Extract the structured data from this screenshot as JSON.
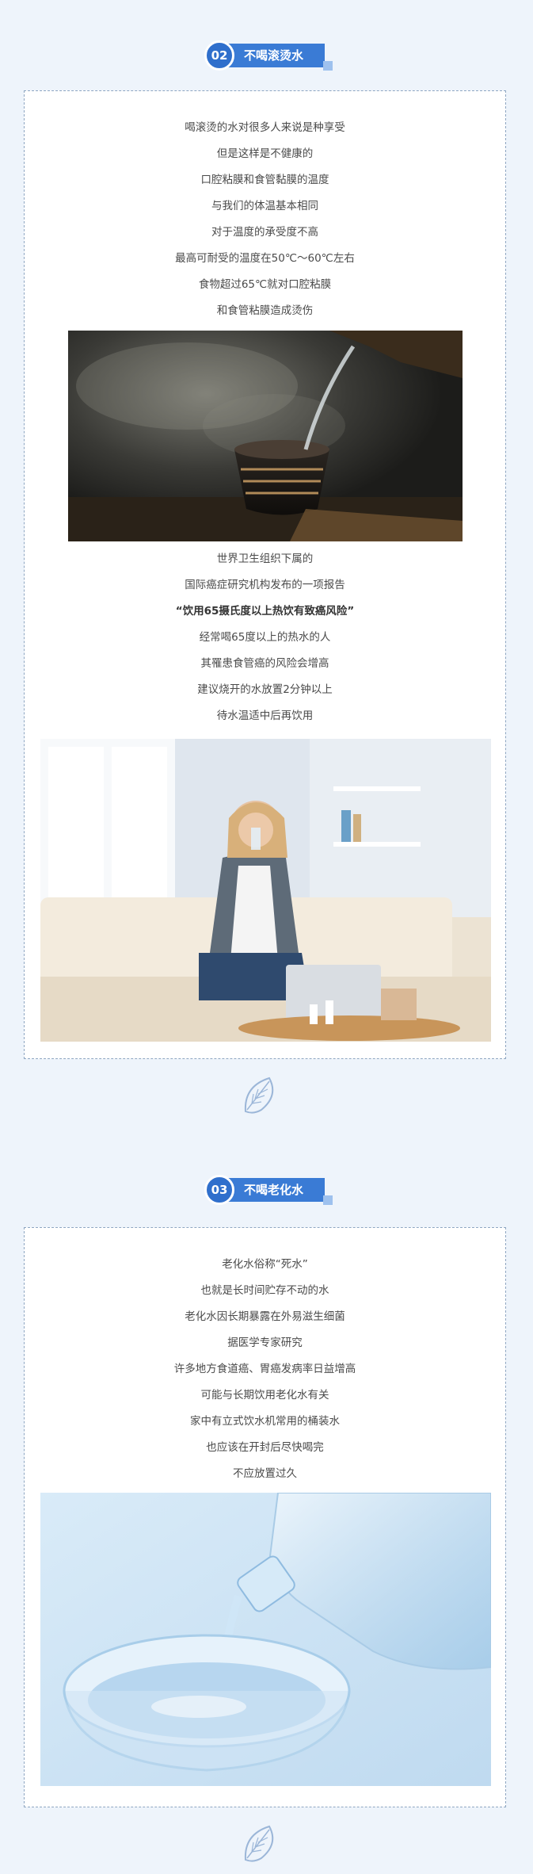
{
  "section2": {
    "number": "02",
    "title": "不喝滚烫水",
    "paragraph1": [
      "喝滚烫的水对很多人来说是种享受",
      "但是这样是不健康的",
      "口腔粘膜和食管黏膜的温度",
      "与我们的体温基本相同",
      "对于温度的承受度不高",
      "最高可耐受的温度在50℃～60℃左右",
      "食物超过65℃就对口腔粘膜",
      "和食管粘膜造成烫伤"
    ],
    "paragraph2": [
      "世界卫生组织下属的",
      "国际癌症研究机构发布的一项报告",
      "“饮用65摄氏度以上热饮有致癌风险”",
      "经常喝65度以上的热水的人",
      "其罹患食管癌的风险会增高",
      "建议烧开的水放置2分钟以上",
      "待水温适中后再饮用"
    ]
  },
  "section3": {
    "number": "03",
    "title": "不喝老化水",
    "paragraph1": [
      "老化水俗称“死水”",
      "也就是长时间贮存不动的水",
      "老化水因长期暴露在外易滋生细菌",
      "据医学专家研究",
      "许多地方食道癌、胃癌发病率日益增高",
      "可能与长期饮用老化水有关",
      "家中有立式饮水机常用的桶装水",
      "也应该在开封后尽快喝完",
      "不应放置过久"
    ]
  },
  "icons": {
    "divider": "leaf-icon"
  },
  "colors": {
    "accent": "#3a7bd5",
    "background": "#eef4fb"
  }
}
